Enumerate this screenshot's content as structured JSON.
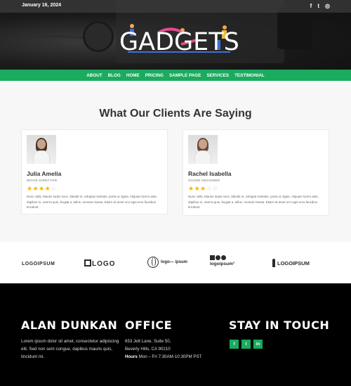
{
  "topbar": {
    "date": "January 16, 2024",
    "social": [
      "f",
      "t",
      "◎"
    ]
  },
  "header": {
    "logo_text": "GADGETS"
  },
  "nav": {
    "items": [
      "ABOUT",
      "BLOG",
      "HOME",
      "PRICING",
      "SAMPLE PAGE",
      "SERVICES",
      "TESTIMONIAL"
    ]
  },
  "testimonials": {
    "heading": "What Our Clients Are Saying",
    "cards": [
      {
        "name": "Julia Amelia",
        "role": "MOVIE DIRECTOR",
        "rating": 4,
        "stars_on": "★★★★",
        "stars_off": "☆",
        "text": "Nunc nulla. Mauris turpis nunc, blandit et, volutpat molestie, porta ut, ligula. Aliquam lorem ante, dapibus in, viverra quis, feugiat a, tellus. Aenean massa. Etiam sit amet orci eget eros faucibus tincidunt."
      },
      {
        "name": "Rachel Isabella",
        "role": "SOUND DESIGNER",
        "rating": 3,
        "stars_on": "★★★",
        "stars_off": "☆☆",
        "text": "Nunc nulla. Mauris turpis nunc, blandit et, volutpat molestie, porta ut, ligula. Aliquam lorem ante, dapibus in, viverra quis, feugiat a, tellus. Aenean massa. Etiam sit amet orci eget eros faucibus tincidunt."
      }
    ]
  },
  "logos": {
    "items": [
      "LOGOIPSUM",
      "LOGO",
      "logo— ipsum",
      "logoipsum°",
      "LOGOIPSUM"
    ]
  },
  "footer": {
    "col1": {
      "title": "ALAN DUNKAN",
      "text": "Lorem ipsum dolor sit amet, consectetur adipiscing elit. Sed non sem congue, dapibus mauris quis, tincidunt mi."
    },
    "col2": {
      "title": "OFFICE",
      "address1": "653 Jett Lane, Suite 50,",
      "address2": "Beverly Hills, CA 90210",
      "hours_label": "Hours",
      "hours_value": " Mon – Fri 7:30AM-10:30PM PST"
    },
    "col3": {
      "title": "STAY IN TOUCH",
      "social": [
        "f",
        "t",
        "in"
      ]
    }
  },
  "colors": {
    "accent": "#1aab5f",
    "star": "#f5b400",
    "footer_bg": "#000000"
  }
}
